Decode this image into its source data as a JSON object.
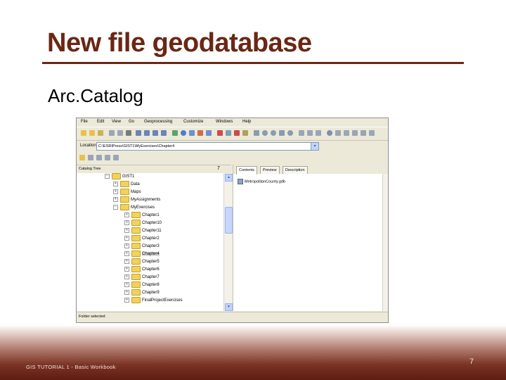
{
  "slide": {
    "title": "New file geodatabase",
    "subtitle": "Arc.Catalog",
    "footer": "GIS TUTORIAL 1 - Basic Workbook",
    "page_number": "7",
    "colors": {
      "title": "#6b2714",
      "footer": "#5e1d12"
    }
  },
  "window": {
    "menu": [
      "File",
      "Edit",
      "View",
      "Go",
      "Geoprocessing",
      "Customize",
      "Windows",
      "Help"
    ],
    "location_label": "Location:",
    "location_value": "C:\\ESRIPress\\GIST1\\MyExercises\\Chapter4",
    "catalog_tree_title": "Catalog Tree",
    "close_glyph": "7",
    "tree": [
      {
        "label": "GIST1",
        "expander": "−",
        "level": 0
      },
      {
        "label": "Data",
        "expander": "+",
        "level": 1
      },
      {
        "label": "Maps",
        "expander": "+",
        "level": 1
      },
      {
        "label": "MyAssignments",
        "expander": "+",
        "level": 1
      },
      {
        "label": "MyExercises",
        "expander": "−",
        "level": 1
      },
      {
        "label": "Chapter1",
        "expander": "+",
        "level": 2
      },
      {
        "label": "Chapter10",
        "expander": "+",
        "level": 2
      },
      {
        "label": "Chapter11",
        "expander": "+",
        "level": 2
      },
      {
        "label": "Chapter2",
        "expander": "+",
        "level": 2
      },
      {
        "label": "Chapter3",
        "expander": "+",
        "level": 2
      },
      {
        "label": "Chapter4",
        "expander": "+",
        "level": 2,
        "selected": true
      },
      {
        "label": "Chapter5",
        "expander": "+",
        "level": 2
      },
      {
        "label": "Chapter6",
        "expander": "+",
        "level": 2
      },
      {
        "label": "Chapter7",
        "expander": "+",
        "level": 2
      },
      {
        "label": "Chapter8",
        "expander": "+",
        "level": 2
      },
      {
        "label": "Chapter9",
        "expander": "+",
        "level": 2
      },
      {
        "label": "FinalProjectExercises",
        "expander": "+",
        "level": 2
      }
    ],
    "tabs": [
      "Contents",
      "Preview",
      "Description"
    ],
    "content_item": "MetropolitanCounty.gdb",
    "status": "Folder selected"
  }
}
